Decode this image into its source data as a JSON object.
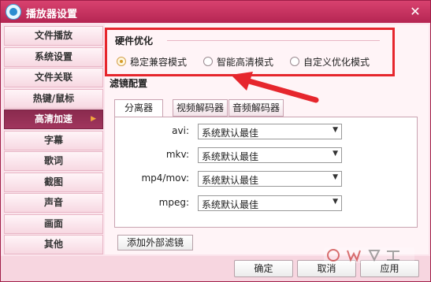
{
  "window": {
    "title": "播放器设置",
    "close_glyph": "✕"
  },
  "sidebar": {
    "items": [
      {
        "label": "文件播放"
      },
      {
        "label": "系统设置"
      },
      {
        "label": "文件关联"
      },
      {
        "label": "热键/鼠标"
      },
      {
        "label": "高清加速",
        "active": true
      },
      {
        "label": "字幕"
      },
      {
        "label": "歌词"
      },
      {
        "label": "截图"
      },
      {
        "label": "声音"
      },
      {
        "label": "画面"
      },
      {
        "label": "其他"
      }
    ]
  },
  "hardware": {
    "title": "硬件优化",
    "options": [
      {
        "label": "稳定兼容模式",
        "checked": true
      },
      {
        "label": "智能高清模式",
        "checked": false
      },
      {
        "label": "自定义优化模式",
        "checked": false
      }
    ]
  },
  "filter": {
    "title": "滤镜配置",
    "tabs": [
      {
        "label": "分离器",
        "active": true
      },
      {
        "label": "视频解码器"
      },
      {
        "label": "音频解码器"
      }
    ],
    "rows": [
      {
        "label": "avi:",
        "value": "系统默认最佳"
      },
      {
        "label": "mkv:",
        "value": "系统默认最佳"
      },
      {
        "label": "mp4/mov:",
        "value": "系统默认最佳"
      },
      {
        "label": "mpeg:",
        "value": "系统默认最佳"
      }
    ],
    "add_button": "添加外部滤镜"
  },
  "footer": {
    "ok": "确定",
    "cancel": "取消",
    "apply": "应用"
  },
  "colors": {
    "accent": "#b52552",
    "annotation": "#e6262d",
    "active_nav": "#8a2a4e"
  },
  "icons": {
    "app": "player-logo-icon",
    "close": "close-icon",
    "nav_arrow": "triangle-right-icon",
    "select_caret": "caret-down-icon"
  }
}
